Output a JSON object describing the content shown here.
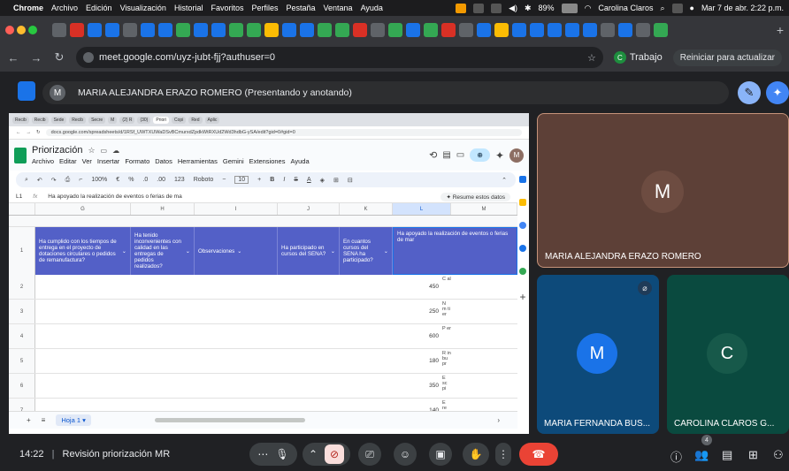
{
  "menubar": {
    "app": "Chrome",
    "items": [
      "Archivo",
      "Edición",
      "Visualización",
      "Historial",
      "Favoritos",
      "Perfiles",
      "Pestaña",
      "Ventana",
      "Ayuda"
    ],
    "battery": "89%",
    "user": "Carolina Claros",
    "datetime": "Mar 7 de abr. 2:22 p.m."
  },
  "browser": {
    "url": "meet.google.com/uyz-jubt-fjj?authuser=0",
    "profile_initial": "C",
    "profile_label": "Trabajo",
    "update_label": "Reiniciar para actualizar"
  },
  "presenter": {
    "initial": "M",
    "label": "MARIA ALEJANDRA ERAZO ROMERO (Presentando y anotando)"
  },
  "shared_screen": {
    "inner_tabs": [
      "Recib",
      "Recib",
      "Sede",
      "Recib",
      "Secre",
      "M",
      "(2) R",
      "(30)",
      "Priori",
      "Copi",
      "Red",
      "Aplic"
    ],
    "inner_url": "docs.google.com/spreadsheets/d/1RSf_UWTXUWaDSvBCmurxdZpdkWtRXUd2Wd3hdbG-ySA/edit?gid=0#gid=0",
    "doc_title": "Priorización",
    "menus": [
      "Archivo",
      "Editar",
      "Ver",
      "Insertar",
      "Formato",
      "Datos",
      "Herramientas",
      "Gemini",
      "Extensiones",
      "Ayuda"
    ],
    "user_initial": "M",
    "toolbar": {
      "zoom": "100%",
      "currency": "€",
      "percent": "%",
      "dec1": ".0",
      "dec2": ".00",
      "num": "123",
      "font": "Roboto",
      "size": "10",
      "bold": "B",
      "italic": "I",
      "strike": "S",
      "textcolor": "A"
    },
    "cell_ref": "L1",
    "fx": "fx",
    "formula": "Ha apoyado la realización de eventos o ferias de ma",
    "resume_label": "Resume estos datos",
    "columns": [
      "G",
      "H",
      "I",
      "J",
      "K",
      "L",
      "M"
    ],
    "header_row_num": "1",
    "headers": [
      "Ha cumplido con los tiempos de entrega en el proyecto de dotaciones circulares o pedidos de remanufactura?",
      "Ha tenido inconvenientes con calidad en las entregas de pedidos realizados?",
      "Observaciones",
      "Ha participado en cursos del SENA?",
      "En cuantos cursos del SENA ha participado?",
      "Ha apoyado la realización de eventos o ferias de mar"
    ],
    "rows": [
      {
        "num": "2",
        "value": "450",
        "trunc": "C al"
      },
      {
        "num": "3",
        "value": "250",
        "trunc": "N m ti er"
      },
      {
        "num": "4",
        "value": "600",
        "trunc": "P er"
      },
      {
        "num": "5",
        "value": "180",
        "trunc": "R in bu pr"
      },
      {
        "num": "6",
        "value": "350",
        "trunc": "E sc pi"
      },
      {
        "num": "7",
        "value": "140",
        "trunc": "E re"
      }
    ],
    "sheet_tab": "Hoja 1",
    "add_sheet": "+",
    "sheet_menu": "≡"
  },
  "tiles": [
    {
      "initial": "M",
      "name": "MARIA ALEJANDRA ERAZO ROMERO",
      "bg": "#5d4037",
      "avatar": "#6d4c41"
    },
    {
      "initial": "M",
      "name": "MARIA FERNANDA BUS...",
      "bg": "#0d4a7a",
      "avatar": "#1a73e8"
    },
    {
      "initial": "C",
      "name": "CAROLINA CLAROS G...",
      "bg": "#0a4a3f",
      "avatar": "#17594a"
    }
  ],
  "bottom": {
    "time": "14:22",
    "separator": "|",
    "meeting": "Revisión priorización MR",
    "participants": "4"
  },
  "colors": {
    "header_blue": "#5360c7",
    "hangup": "#ea4335",
    "present_blue": "#1a73e8"
  }
}
